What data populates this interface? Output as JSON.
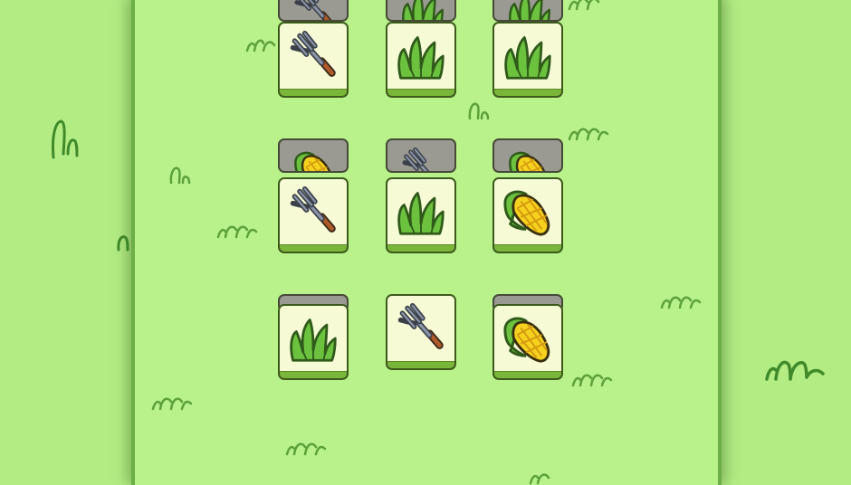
{
  "game": {
    "background_color": "#b4ec84",
    "board_color": "#b9f28a",
    "tile_face_color": "#f6fbd6",
    "tile_base_color": "#7ab63a",
    "tile_back_color": "#9a9a92",
    "tiles": [
      {
        "icon": "rake-icon",
        "under": "rake-icon"
      },
      {
        "icon": "grass-icon",
        "under": "grass-icon"
      },
      {
        "icon": "grass-icon",
        "under": "grass-icon"
      },
      {
        "icon": "rake-icon",
        "under": "corn-icon"
      },
      {
        "icon": "grass-icon",
        "under": "rake-icon"
      },
      {
        "icon": "corn-icon",
        "under": "corn-icon"
      },
      {
        "icon": "grass-icon",
        "under": "blank"
      },
      {
        "icon": "rake-icon",
        "under": "none"
      },
      {
        "icon": "corn-icon",
        "under": "blank"
      }
    ]
  }
}
